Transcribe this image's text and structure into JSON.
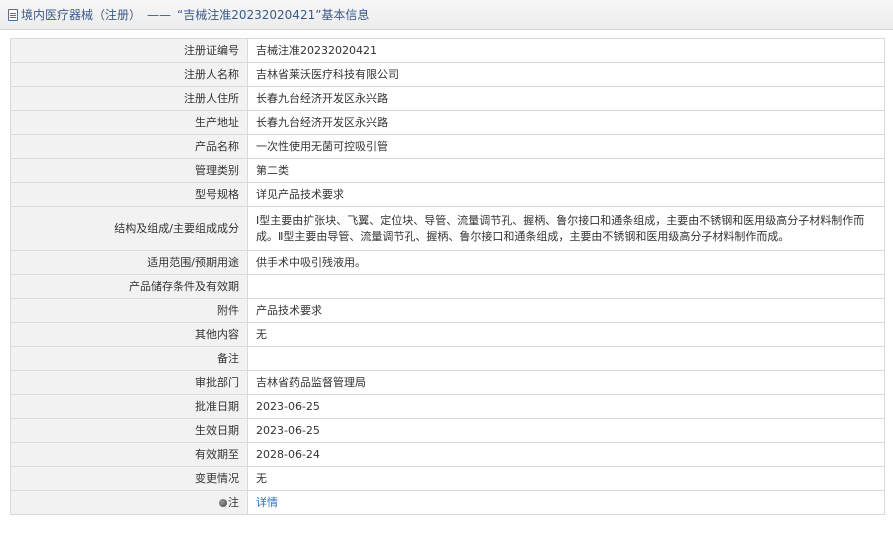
{
  "header": {
    "category": "境内医疗器械（注册）",
    "separator": "——",
    "title": "“吉械注准20232020421”基本信息"
  },
  "rows": [
    {
      "label": "注册证编号",
      "value": "吉械注准20232020421"
    },
    {
      "label": "注册人名称",
      "value": "吉林省莱沃医疗科技有限公司"
    },
    {
      "label": "注册人住所",
      "value": "长春九台经济开发区永兴路"
    },
    {
      "label": "生产地址",
      "value": "长春九台经济开发区永兴路"
    },
    {
      "label": "产品名称",
      "value": "一次性使用无菌可控吸引管"
    },
    {
      "label": "管理类别",
      "value": "第二类"
    },
    {
      "label": "型号规格",
      "value": "详见产品技术要求"
    },
    {
      "label": "结构及组成/主要组成成分",
      "value": "Ⅰ型主要由扩张块、飞翼、定位块、导管、流量调节孔、握柄、鲁尔接口和通条组成，主要由不锈钢和医用级高分子材料制作而成。Ⅱ型主要由导管、流量调节孔、握柄、鲁尔接口和通条组成，主要由不锈钢和医用级高分子材料制作而成。"
    },
    {
      "label": "适用范围/预期用途",
      "value": "供手术中吸引残液用。"
    },
    {
      "label": "产品储存条件及有效期",
      "value": ""
    },
    {
      "label": "附件",
      "value": "产品技术要求"
    },
    {
      "label": "其他内容",
      "value": "无"
    },
    {
      "label": "备注",
      "value": ""
    },
    {
      "label": "审批部门",
      "value": "吉林省药品监督管理局"
    },
    {
      "label": "批准日期",
      "value": "2023-06-25"
    },
    {
      "label": "生效日期",
      "value": "2023-06-25"
    },
    {
      "label": "有效期至",
      "value": "2028-06-24"
    },
    {
      "label": "变更情况",
      "value": "无"
    }
  ],
  "note_row": {
    "label": "注",
    "link_text": "详情"
  }
}
